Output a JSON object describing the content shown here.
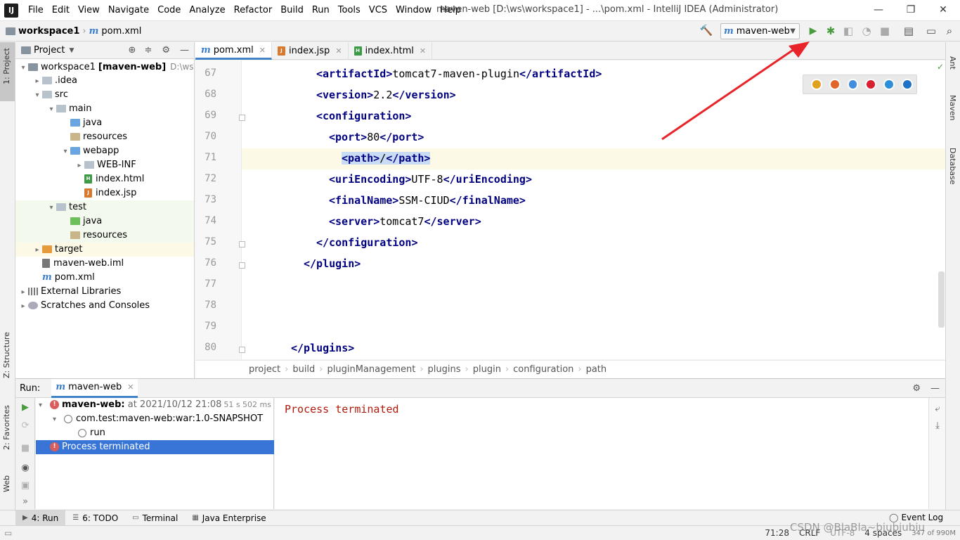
{
  "window": {
    "logo": "IJ",
    "title": "maven-web [D:\\ws\\workspace1] - ...\\pom.xml - IntelliJ IDEA (Administrator)",
    "minimize": "—",
    "maximize": "❐",
    "close": "✕"
  },
  "menu": [
    "File",
    "Edit",
    "View",
    "Navigate",
    "Code",
    "Analyze",
    "Refactor",
    "Build",
    "Run",
    "Tools",
    "VCS",
    "Window",
    "Help"
  ],
  "navbar": {
    "project": "workspace1",
    "file": "pom.xml",
    "run_config": "maven-web"
  },
  "left_stripe": {
    "project_tab": "1: Project",
    "structure_tab": "Z: Structure",
    "favorites_tab": "2: Favorites",
    "web_tab": "Web"
  },
  "right_stripe": {
    "ant_tab": "Ant",
    "maven_tab": "Maven",
    "database_tab": "Database"
  },
  "project_panel": {
    "title": "Project",
    "tree": [
      {
        "indent": 0,
        "arrow": "▾",
        "icon": "folder",
        "color": "#87939f",
        "label": "workspace1",
        "bold_suffix": "[maven-web]",
        "hint": "D:\\ws\\wo"
      },
      {
        "indent": 1,
        "arrow": "▸",
        "icon": "folder",
        "color": "#b8c2cc",
        "label": ".idea"
      },
      {
        "indent": 1,
        "arrow": "▾",
        "icon": "folder",
        "color": "#b8c2cc",
        "label": "src"
      },
      {
        "indent": 2,
        "arrow": "▾",
        "icon": "folder",
        "color": "#b8c2cc",
        "label": "main"
      },
      {
        "indent": 3,
        "arrow": "",
        "icon": "folder",
        "color": "#6aa5e0",
        "label": "java"
      },
      {
        "indent": 3,
        "arrow": "",
        "icon": "folder",
        "color": "#c8b58a",
        "label": "resources"
      },
      {
        "indent": 3,
        "arrow": "▾",
        "icon": "folder",
        "color": "#6aa5e0",
        "label": "webapp"
      },
      {
        "indent": 4,
        "arrow": "▸",
        "icon": "folder",
        "color": "#b8c2cc",
        "label": "WEB-INF"
      },
      {
        "indent": 4,
        "arrow": "",
        "icon": "file",
        "color": "#3d9b46",
        "glyph": "H",
        "label": "index.html"
      },
      {
        "indent": 4,
        "arrow": "",
        "icon": "file",
        "color": "#d9792e",
        "glyph": "J",
        "label": "index.jsp"
      },
      {
        "indent": 2,
        "arrow": "▾",
        "icon": "folder",
        "color": "#b8c2cc",
        "label": "test"
      },
      {
        "indent": 3,
        "arrow": "",
        "icon": "folder",
        "color": "#6cbf5a",
        "label": "java"
      },
      {
        "indent": 3,
        "arrow": "",
        "icon": "folder",
        "color": "#c8b58a",
        "label": "resources"
      },
      {
        "indent": 1,
        "arrow": "▸",
        "icon": "folder",
        "color": "#e59a3b",
        "label": "target"
      },
      {
        "indent": 1,
        "arrow": "",
        "icon": "file",
        "color": "#777777",
        "glyph": "",
        "label": "maven-web.iml"
      },
      {
        "indent": 1,
        "arrow": "",
        "icon": "maven",
        "color": "#3d7ec9",
        "label": "pom.xml"
      },
      {
        "indent": 0,
        "arrow": "▸",
        "icon": "lib",
        "color": "#777777",
        "label": "External Libraries"
      },
      {
        "indent": 0,
        "arrow": "▸",
        "icon": "scratch",
        "color": "#777777",
        "label": "Scratches and Consoles"
      }
    ]
  },
  "editor_tabs": [
    {
      "label": "pom.xml",
      "icon": "maven",
      "active": true
    },
    {
      "label": "index.jsp",
      "icon": "jsp",
      "active": false
    },
    {
      "label": "index.html",
      "icon": "html",
      "active": false
    }
  ],
  "tab_close": "✕",
  "code_lines": [
    {
      "n": "67",
      "indent": 8,
      "parts": [
        [
          "tag",
          "<artifactId>"
        ],
        [
          "text",
          "tomcat7-maven-plugin"
        ],
        [
          "tag",
          "</artifactId>"
        ]
      ]
    },
    {
      "n": "68",
      "indent": 8,
      "parts": [
        [
          "tag",
          "<version>"
        ],
        [
          "text",
          "2.2"
        ],
        [
          "tag",
          "</version>"
        ]
      ]
    },
    {
      "n": "69",
      "indent": 8,
      "parts": [
        [
          "tag",
          "<configuration>"
        ]
      ]
    },
    {
      "n": "70",
      "indent": 10,
      "parts": [
        [
          "tag",
          "<port>"
        ],
        [
          "text",
          "80"
        ],
        [
          "tag",
          "</port>"
        ]
      ]
    },
    {
      "n": "71",
      "indent": 12,
      "parts": [
        [
          "tag",
          "<path>"
        ],
        [
          "text",
          "/"
        ],
        [
          "tag",
          "</path>"
        ]
      ]
    },
    {
      "n": "72",
      "indent": 10,
      "parts": [
        [
          "tag",
          "<uriEncoding>"
        ],
        [
          "text",
          "UTF-8"
        ],
        [
          "tag",
          "</uriEncoding>"
        ]
      ]
    },
    {
      "n": "73",
      "indent": 10,
      "parts": [
        [
          "tag",
          "<finalName>"
        ],
        [
          "text",
          "SSM-CIUD"
        ],
        [
          "tag",
          "</finalName>"
        ]
      ]
    },
    {
      "n": "74",
      "indent": 10,
      "parts": [
        [
          "tag",
          "<server>"
        ],
        [
          "text",
          "tomcat7"
        ],
        [
          "tag",
          "</server>"
        ]
      ]
    },
    {
      "n": "75",
      "indent": 8,
      "parts": [
        [
          "tag",
          "</configuration>"
        ]
      ]
    },
    {
      "n": "76",
      "indent": 6,
      "parts": [
        [
          "tag",
          "</plugin>"
        ]
      ]
    },
    {
      "n": "77",
      "indent": 0,
      "parts": []
    },
    {
      "n": "78",
      "indent": 0,
      "parts": []
    },
    {
      "n": "79",
      "indent": 0,
      "parts": []
    },
    {
      "n": "80",
      "indent": 4,
      "parts": [
        [
          "tag",
          "</plugins>"
        ]
      ]
    }
  ],
  "editor_breadcrumb": [
    "project",
    "build",
    "pluginManagement",
    "plugins",
    "plugin",
    "configuration",
    "path"
  ],
  "browsers": [
    {
      "name": "chrome-icon",
      "color": "#e0a020"
    },
    {
      "name": "firefox-icon",
      "color": "#e0662a"
    },
    {
      "name": "safari-icon",
      "color": "#3f8ee0"
    },
    {
      "name": "opera-icon",
      "color": "#d8202f"
    },
    {
      "name": "ie-icon",
      "color": "#2c8fd8"
    },
    {
      "name": "edge-icon",
      "color": "#1f73c7"
    }
  ],
  "run_panel": {
    "label": "Run:",
    "tab": "maven-web",
    "tree": [
      {
        "indent": 0,
        "arrow": "▾",
        "icon": "err",
        "label": "maven-web:",
        "bold": true,
        "suffix": " at 2021/10/12 21:08",
        "time": "51 s 502 ms"
      },
      {
        "indent": 1,
        "arrow": "▾",
        "icon": "none",
        "label": "com.test:maven-web:war:1.0-SNAPSHOT"
      },
      {
        "indent": 2,
        "arrow": "",
        "icon": "none",
        "label": "run"
      },
      {
        "indent": 0,
        "arrow": "",
        "icon": "err",
        "label": "Process terminated",
        "selected": true
      }
    ],
    "console": "Process terminated"
  },
  "tool_tabs": [
    {
      "label": "4: Run",
      "icon": "▶",
      "active": true
    },
    {
      "label": "6: TODO",
      "icon": "☰",
      "active": false
    },
    {
      "label": "Terminal",
      "icon": "▭",
      "active": false
    },
    {
      "label": "Java Enterprise",
      "icon": "▦",
      "active": false
    }
  ],
  "event_log": "Event Log",
  "status": {
    "position": "71:28",
    "line_sep": "CRLF",
    "encoding": "UTF-8",
    "indent": "4 spaces",
    "memory": "347 of 990M",
    "watermark": "CSDN @BlaBla~biubiubiu"
  },
  "colors": {
    "accent": "#3875d7",
    "tag": "#000080",
    "error": "#db5c5c",
    "console_error": "#b0180b",
    "run_green": "#4a9d3f",
    "arrow_red": "#e8242a"
  }
}
